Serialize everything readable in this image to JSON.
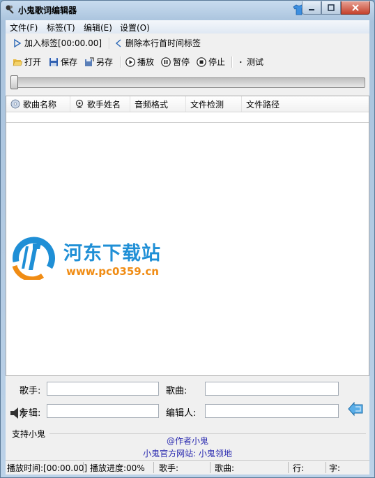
{
  "window": {
    "title": "小鬼歌词编辑器"
  },
  "menu": [
    "文件(F)",
    "标签(T)",
    "编辑(E)",
    "设置(O)"
  ],
  "toolbar1": {
    "add_tag": "加入标签[00:00.00]",
    "delete_tag": "删除本行首时间标签"
  },
  "toolbar2": {
    "open": "打开",
    "save": "保存",
    "save_as": "另存",
    "play": "播放",
    "pause": "暂停",
    "stop": "停止",
    "test": "测试"
  },
  "slider": {
    "value": 0
  },
  "columns": [
    "歌曲名称",
    "歌手姓名",
    "音频格式",
    "文件检测",
    "文件路径"
  ],
  "watermark": {
    "site_name": "河东下载站",
    "url": "www.pc0359.cn"
  },
  "form": {
    "singer_label": "歌手:",
    "singer_value": "",
    "song_label": "歌曲:",
    "song_value": "",
    "album_label": "专辑:",
    "album_value": "",
    "editor_label": "编辑人:",
    "editor_value": ""
  },
  "support": {
    "group_title": "支持小鬼",
    "author": "@作者小鬼",
    "website": "小鬼官方网站: 小鬼领地"
  },
  "status": {
    "play_time": "播放时间:[00:00.00]",
    "progress": "播放进度:00%",
    "singer": "歌手:",
    "song": "歌曲:",
    "line": "行:",
    "char": "字:"
  }
}
